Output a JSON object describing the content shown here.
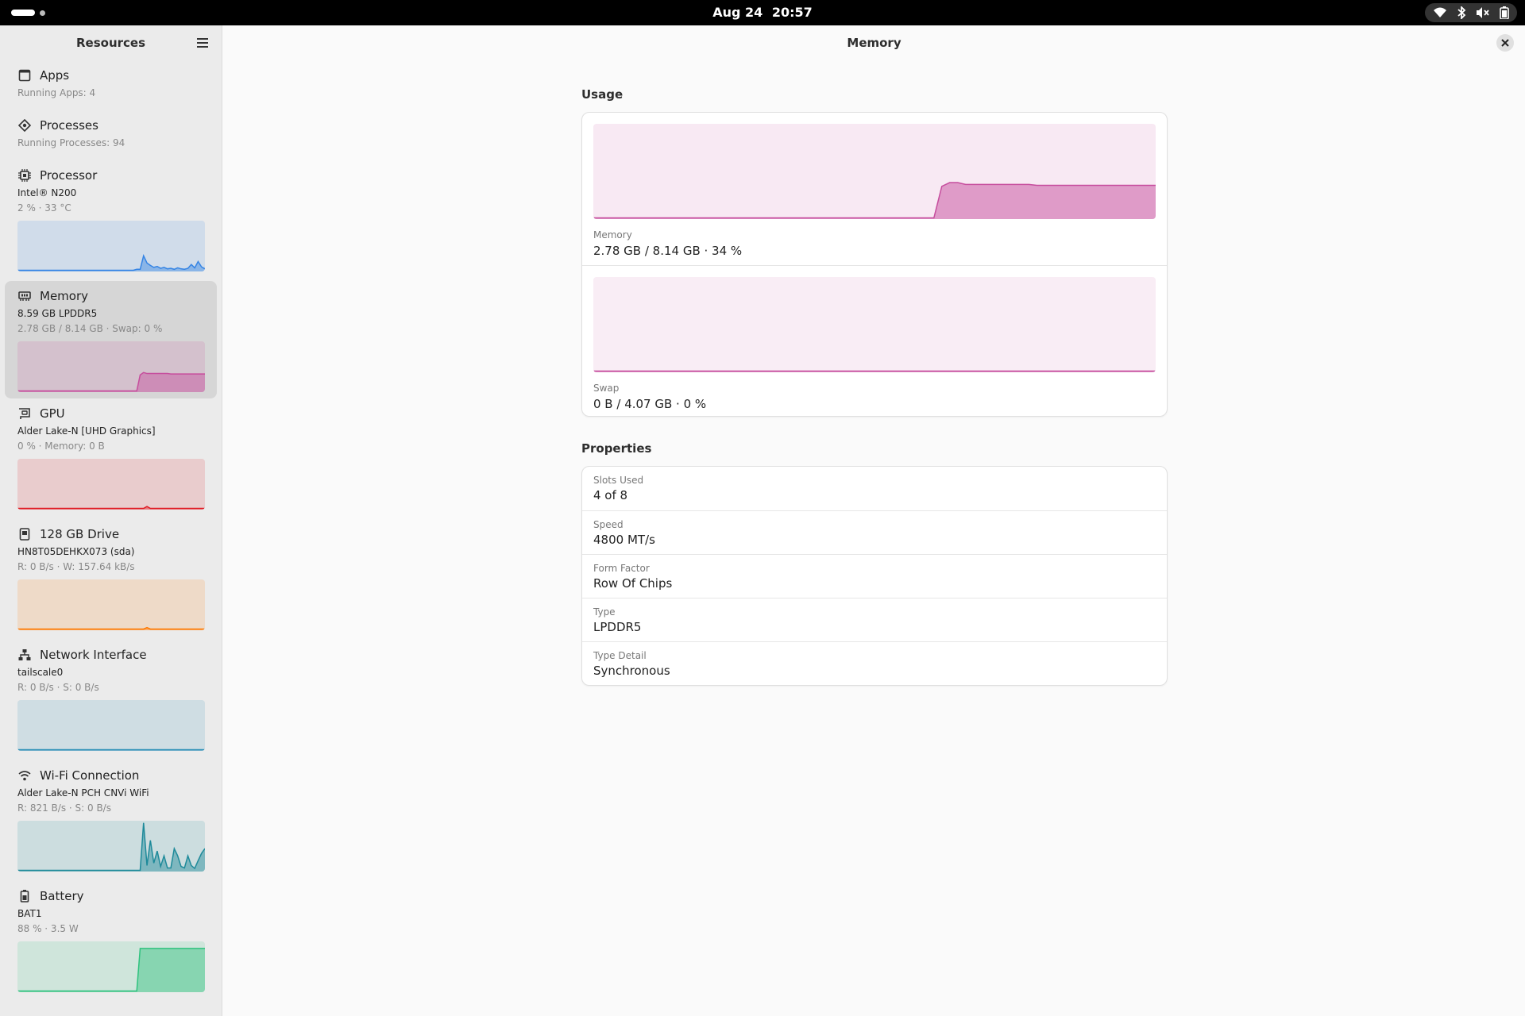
{
  "topbar": {
    "date": "Aug 24",
    "time": "20:57",
    "icons": [
      "wifi-icon",
      "bluetooth-icon",
      "volume-muted-icon",
      "battery-icon"
    ]
  },
  "sidebar": {
    "title": "Resources",
    "items": [
      {
        "name": "Apps",
        "line1": "Running Apps: 4",
        "icon": "apps-icon"
      },
      {
        "name": "Processes",
        "line1": "Running Processes: 94",
        "icon": "processes-icon"
      },
      {
        "name": "Processor",
        "line1": "Intel® N200",
        "line2": "2 % · 33 °C",
        "icon": "processor-icon",
        "color": "#3584e4"
      },
      {
        "name": "Memory",
        "line1": "8.59 GB LPDDR5",
        "line2": "2.78 GB / 8.14 GB · Swap: 0 %",
        "icon": "memory-icon",
        "color": "#c64d9d",
        "selected": true
      },
      {
        "name": "GPU",
        "line1": "Alder Lake-N [UHD Graphics]",
        "line2": "0 % · Memory: 0 B",
        "icon": "gpu-icon",
        "color": "#e01b24"
      },
      {
        "name": "128 GB Drive",
        "line1": "HN8T05DEHKX073 (sda)",
        "line2": "R: 0 B/s · W: 157.64 kB/s",
        "icon": "drive-icon",
        "color": "#ff7800"
      },
      {
        "name": "Network Interface",
        "line1": "tailscale0",
        "line2": "R: 0 B/s · S: 0 B/s",
        "icon": "network-icon",
        "color": "#2c8fb7"
      },
      {
        "name": "Wi-Fi Connection",
        "line1": "Alder Lake-N PCH CNVi WiFi",
        "line2": "R: 821 B/s · S: 0 B/s",
        "icon": "wifi-icon",
        "color": "#1e8a9a"
      },
      {
        "name": "Battery",
        "line1": "BAT1",
        "line2": "88 % · 3.5 W",
        "icon": "battery-icon",
        "color": "#2ec27e"
      }
    ]
  },
  "main": {
    "title": "Memory",
    "usage_title": "Usage",
    "memory_caption": "Memory",
    "memory_value": "2.78 GB / 8.14 GB · 34 %",
    "swap_caption": "Swap",
    "swap_value": "0 B / 4.07 GB · 0 %",
    "properties_title": "Properties",
    "properties": [
      {
        "label": "Slots Used",
        "value": "4 of 8"
      },
      {
        "label": "Speed",
        "value": "4800 MT/s"
      },
      {
        "label": "Form Factor",
        "value": "Row Of Chips"
      },
      {
        "label": "Type",
        "value": "LPDDR5"
      },
      {
        "label": "Type Detail",
        "value": "Synchronous"
      }
    ]
  },
  "graphs": {
    "memory_color": "#c64d9d",
    "history_note": "usage fraction over time, oldest first",
    "memory_history": [
      0,
      0,
      0,
      0,
      0,
      0,
      0,
      0,
      0,
      0,
      0,
      0,
      0,
      0,
      0,
      0,
      0,
      0,
      0,
      0,
      0,
      0,
      0,
      0,
      0,
      0,
      0,
      0,
      0,
      0,
      0,
      0,
      0,
      0,
      0,
      0,
      0,
      0,
      0,
      0,
      0,
      0,
      0,
      0,
      0.34,
      0.38,
      0.38,
      0.36,
      0.36,
      0.36,
      0.36,
      0.36,
      0.36,
      0.36,
      0.36,
      0.36,
      0.35,
      0.35,
      0.35,
      0.35,
      0.35,
      0.35,
      0.35,
      0.35,
      0.35,
      0.35,
      0.35,
      0.35,
      0.35,
      0.35,
      0.35,
      0.35
    ],
    "swap_history": [
      0,
      0,
      0,
      0,
      0,
      0,
      0,
      0,
      0,
      0,
      0,
      0,
      0,
      0,
      0,
      0,
      0,
      0,
      0,
      0,
      0,
      0,
      0,
      0,
      0,
      0,
      0,
      0,
      0,
      0,
      0,
      0,
      0,
      0,
      0,
      0,
      0,
      0,
      0,
      0,
      0,
      0,
      0,
      0,
      0,
      0,
      0,
      0,
      0,
      0,
      0,
      0,
      0,
      0,
      0,
      0,
      0,
      0,
      0,
      0,
      0,
      0,
      0,
      0,
      0,
      0,
      0,
      0,
      0,
      0,
      0,
      0
    ],
    "sidebar_history": {
      "Processor": [
        0,
        0,
        0,
        0,
        0,
        0,
        0,
        0,
        0,
        0,
        0,
        0,
        0,
        0,
        0,
        0,
        0,
        0,
        0,
        0,
        0,
        0,
        0,
        0,
        0,
        0,
        0,
        0,
        0,
        0,
        0,
        0,
        0,
        0,
        0,
        0.02,
        0.02,
        0.3,
        0.15,
        0.1,
        0.06,
        0.08,
        0.04,
        0.06,
        0.03,
        0.04,
        0.02,
        0.05,
        0.03,
        0.02,
        0.04,
        0.12,
        0.05,
        0.18,
        0.07,
        0.03
      ],
      "Memory": [
        0,
        0,
        0,
        0,
        0,
        0,
        0,
        0,
        0,
        0,
        0,
        0,
        0,
        0,
        0,
        0,
        0,
        0,
        0,
        0,
        0,
        0,
        0,
        0,
        0,
        0,
        0,
        0,
        0,
        0,
        0,
        0,
        0,
        0,
        0,
        0,
        0.33,
        0.38,
        0.36,
        0.36,
        0.36,
        0.36,
        0.36,
        0.36,
        0.36,
        0.35,
        0.35,
        0.35,
        0.35,
        0.35,
        0.35,
        0.35,
        0.35,
        0.35,
        0.35,
        0.35
      ],
      "GPU": [
        0,
        0,
        0,
        0,
        0,
        0,
        0,
        0,
        0,
        0,
        0,
        0,
        0,
        0,
        0,
        0,
        0,
        0,
        0,
        0,
        0,
        0,
        0,
        0,
        0,
        0,
        0,
        0,
        0,
        0,
        0,
        0,
        0,
        0,
        0,
        0,
        0,
        0,
        0.04,
        0,
        0,
        0,
        0,
        0,
        0,
        0,
        0,
        0,
        0,
        0,
        0,
        0,
        0,
        0,
        0,
        0
      ],
      "128 GB Drive": [
        0,
        0,
        0,
        0,
        0,
        0,
        0,
        0,
        0,
        0,
        0,
        0,
        0,
        0,
        0,
        0,
        0,
        0,
        0,
        0,
        0,
        0,
        0,
        0,
        0,
        0,
        0,
        0,
        0,
        0,
        0,
        0,
        0,
        0,
        0,
        0,
        0,
        0,
        0.03,
        0,
        0,
        0,
        0,
        0,
        0,
        0,
        0,
        0,
        0,
        0,
        0,
        0,
        0,
        0,
        0,
        0
      ],
      "Network Interface": [
        0,
        0,
        0,
        0,
        0,
        0,
        0,
        0,
        0,
        0,
        0,
        0,
        0,
        0,
        0,
        0,
        0,
        0,
        0,
        0,
        0,
        0,
        0,
        0,
        0,
        0,
        0,
        0,
        0,
        0,
        0,
        0,
        0,
        0,
        0,
        0,
        0,
        0,
        0,
        0,
        0,
        0,
        0,
        0,
        0,
        0,
        0,
        0,
        0,
        0,
        0,
        0,
        0,
        0,
        0,
        0
      ],
      "Wi-Fi Connection": [
        0,
        0,
        0,
        0,
        0,
        0,
        0,
        0,
        0,
        0,
        0,
        0,
        0,
        0,
        0,
        0,
        0,
        0,
        0,
        0,
        0,
        0,
        0,
        0,
        0,
        0,
        0,
        0,
        0,
        0,
        0,
        0,
        0,
        0,
        0,
        0,
        0,
        0.98,
        0.1,
        0.62,
        0.15,
        0.4,
        0.08,
        0.3,
        0.05,
        0.05,
        0.45,
        0.3,
        0.08,
        0.05,
        0.3,
        0.1,
        0.04,
        0.2,
        0.35,
        0.45
      ],
      "Battery": [
        0,
        0,
        0,
        0,
        0,
        0,
        0,
        0,
        0,
        0,
        0,
        0,
        0,
        0,
        0,
        0,
        0,
        0,
        0,
        0,
        0,
        0,
        0,
        0,
        0,
        0,
        0,
        0,
        0,
        0,
        0,
        0,
        0,
        0,
        0,
        0,
        0.88,
        0.88,
        0.88,
        0.88,
        0.88,
        0.88,
        0.88,
        0.88,
        0.88,
        0.88,
        0.88,
        0.88,
        0.88,
        0.88,
        0.88,
        0.88,
        0.88,
        0.88,
        0.88,
        0.88
      ]
    }
  }
}
